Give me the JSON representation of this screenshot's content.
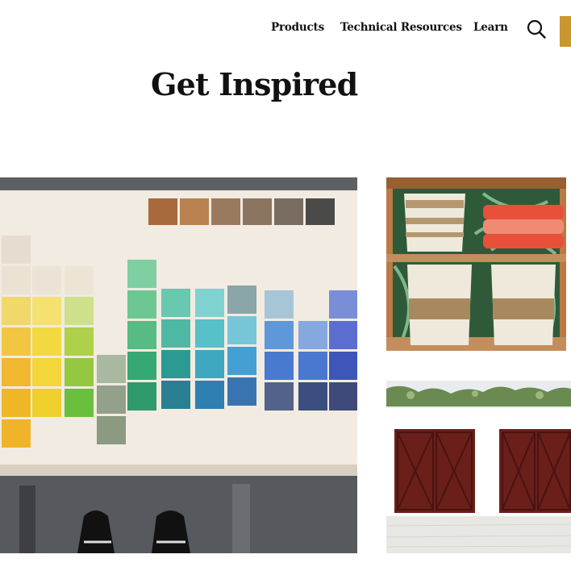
{
  "nav": {
    "products": "Products",
    "technical_resources": "Technical Resources",
    "learn": "Learn",
    "search_icon": "search-icon"
  },
  "page": {
    "title": "Get Inspired"
  },
  "gallery": {
    "items": [
      {
        "name": "wood-stain-color-swatches"
      },
      {
        "name": "woven-storage-baskets-on-shelves"
      },
      {
        "name": "stained-wood-garage-doors"
      }
    ]
  },
  "colors": {
    "accent": "#c9962f",
    "text": "#111111",
    "background": "#ffffff"
  }
}
